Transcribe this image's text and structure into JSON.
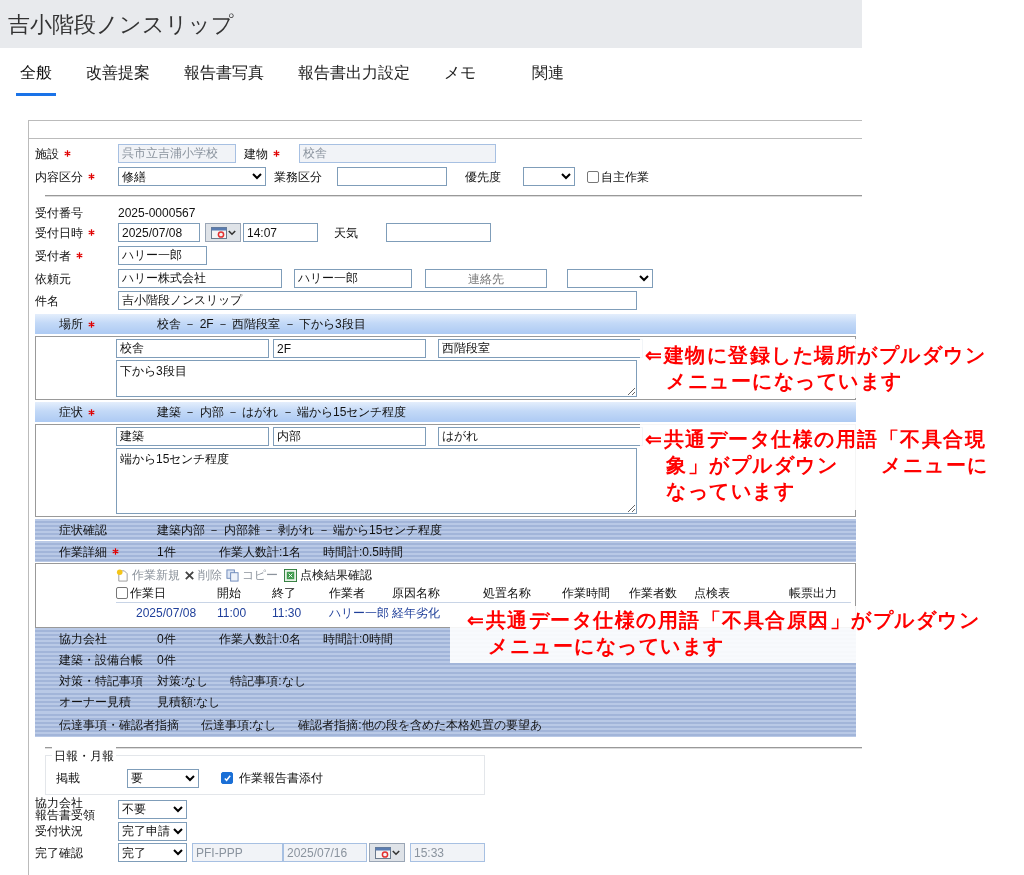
{
  "title": "吉小階段ノンスリップ",
  "tabs": [
    {
      "label": "全般",
      "selected": true
    },
    {
      "label": "改善提案",
      "selected": false
    },
    {
      "label": "報告書写真",
      "selected": false
    },
    {
      "label": "報告書出力設定",
      "selected": false
    },
    {
      "label": "メモ",
      "selected": false
    },
    {
      "label": "関連",
      "selected": false
    }
  ],
  "facility": {
    "label": "施設",
    "required": true,
    "value": "呉市立吉浦小学校",
    "disabled": true
  },
  "building": {
    "label": "建物",
    "required": true,
    "value": "校舎",
    "disabled": true
  },
  "content_type": {
    "label": "内容区分",
    "required": true,
    "value": "修繕"
  },
  "business_type": {
    "label": "業務区分"
  },
  "priority": {
    "label": "優先度"
  },
  "self_work": {
    "label": "自主作業",
    "checked": false
  },
  "receipt_no": {
    "label": "受付番号",
    "value": "2025-0000567"
  },
  "receipt_datetime": {
    "label": "受付日時",
    "required": true,
    "date": "2025/07/08",
    "time": "14:07"
  },
  "weather": {
    "label": "天気"
  },
  "receiver": {
    "label": "受付者",
    "required": true,
    "value": "ハリー一郎"
  },
  "requester": {
    "label": "依頼元",
    "company": "ハリー株式会社",
    "person": "ハリー一郎",
    "contact_placeholder": "連絡先"
  },
  "subject": {
    "label": "件名",
    "value": "吉小階段ノンスリップ"
  },
  "location": {
    "label": "場所",
    "required": true,
    "summary": "校舎 － 2F － 西階段室 － 下から3段目",
    "fields": [
      "校舎",
      "2F",
      "西階段室"
    ],
    "detail": "下から3段目"
  },
  "symptom": {
    "label": "症状",
    "required": true,
    "summary": "建築 － 内部 － はがれ － 端から15センチ程度",
    "fields": [
      "建築",
      "内部",
      "はがれ"
    ],
    "detail": "端から15センチ程度"
  },
  "sections_before": [
    {
      "label": "症状確認",
      "required": false,
      "items": [
        "建築内部 － 内部雑 － 剥がれ － 端から15センチ程度"
      ]
    },
    {
      "label": "作業詳細",
      "required": true,
      "items": [
        "1件",
        "作業人数計:1名",
        "時間計:0.5時間"
      ]
    }
  ],
  "work_toolbar": [
    {
      "kind": "new",
      "label": "作業新規",
      "disabled": true
    },
    {
      "kind": "delete",
      "label": "削除",
      "disabled": true
    },
    {
      "kind": "copy",
      "label": "コピー",
      "disabled": true
    },
    {
      "kind": "sheet",
      "label": "点検結果確認",
      "disabled": false
    }
  ],
  "work_table": {
    "select_all": {
      "checked": false
    },
    "columns": [
      "作業日",
      "開始",
      "終了",
      "作業者",
      "原因名称",
      "処置名称",
      "作業時間",
      "作業者数",
      "点検表",
      "帳票出力"
    ],
    "rows": [
      {
        "cells": [
          "2025/07/08",
          "11:00",
          "11:30",
          "ハリー一郎",
          "経年劣化"
        ]
      }
    ]
  },
  "sections_after": [
    {
      "label": "協力会社",
      "required": false,
      "items": [
        "0件",
        "作業人数計:0名",
        "時間計:0時間"
      ]
    },
    {
      "label": "建築・設備台帳",
      "required": false,
      "items": [
        "0件"
      ]
    },
    {
      "label": "対策・特記事項",
      "required": false,
      "items": [
        "対策:なし",
        "特記事項:なし"
      ]
    },
    {
      "label": "オーナー見積",
      "required": false,
      "items": [
        "見積額:なし"
      ]
    },
    {
      "label": "伝達事項・確認者指摘",
      "required": false,
      "items": [
        "伝達事項:なし",
        "確認者指摘:他の段を含めた本格処置の要望あ"
      ]
    }
  ],
  "daily_monthly": {
    "legend": "日報・月報",
    "publish": {
      "label": "掲載",
      "value": "要"
    },
    "attach": {
      "label": "作業報告書添付",
      "checked": true
    }
  },
  "partner_report": {
    "label_lines": [
      "協力会社",
      "報告書受領"
    ],
    "value": "不要"
  },
  "receipt_status": {
    "label": "受付状況",
    "value": "完了申請"
  },
  "completion": {
    "label": "完了確認",
    "value": "完了",
    "code": "PFI-PPP",
    "date": "2025/07/16",
    "time": "15:33",
    "disabled": true
  },
  "annotations": [
    {
      "lines": [
        "⇐建物に登録した場所がプルダウン",
        "メニューになっています"
      ]
    },
    {
      "lines": [
        "⇐共通データ仕様の用語「不具合現",
        "象」がプルダウン　　メニューに",
        "なっています"
      ]
    },
    {
      "lines": [
        "⇐共通データ仕様の用語「不具合原因」がプルダウン",
        "メニューになっています"
      ]
    }
  ]
}
